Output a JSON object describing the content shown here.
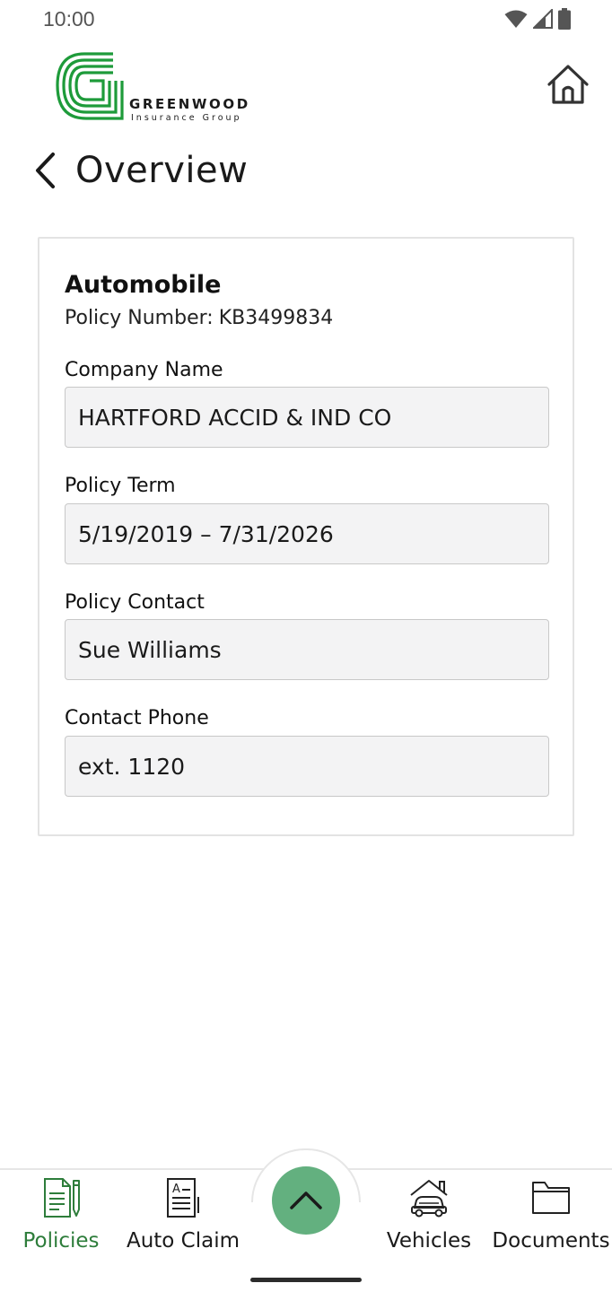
{
  "status_bar": {
    "time": "10:00",
    "icons": [
      "wifi-icon",
      "cell-signal-icon",
      "battery-icon"
    ]
  },
  "header": {
    "logo": {
      "word": "GREENWOOD",
      "sub": "Insurance Group",
      "color": "#1e9b3a"
    },
    "home_icon": "home-icon",
    "back_icon": "chevron-left-icon",
    "title": "Overview"
  },
  "policy": {
    "type": "Automobile",
    "number_label": "Policy Number:",
    "number": "KB3499834",
    "fields": [
      {
        "label": "Company Name",
        "value": "HARTFORD ACCID & IND CO"
      },
      {
        "label": "Policy Term",
        "value": "5/19/2019 – 7/31/2026"
      },
      {
        "label": "Policy Contact",
        "value": "Sue Williams"
      },
      {
        "label": "Contact Phone",
        "value": "ext. 1120"
      }
    ]
  },
  "bottom_nav": {
    "items": [
      {
        "label": "Policies",
        "icon": "policy-document-icon",
        "active": true
      },
      {
        "label": "Auto Claim",
        "icon": "claim-form-icon",
        "active": false
      },
      {
        "label": "Vehicles",
        "icon": "car-garage-icon",
        "active": false
      },
      {
        "label": "Documents",
        "icon": "folder-icon",
        "active": false
      }
    ],
    "fab_icon": "chevron-up-icon",
    "fab_color": "#63b07f",
    "active_color": "#2e7d3b"
  }
}
